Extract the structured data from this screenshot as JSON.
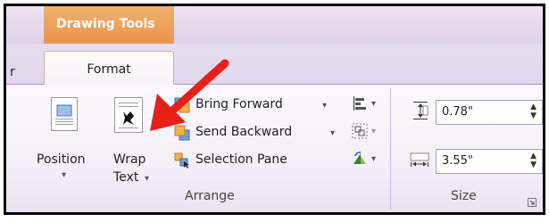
{
  "contextual_tab": {
    "title": "Drawing Tools"
  },
  "tabs": {
    "previous_partial": "r",
    "active": "Format"
  },
  "arrange": {
    "position_label": "Position",
    "wrap_text_label_1": "Wrap",
    "wrap_text_label_2": "Text",
    "bring_forward_label": "Bring Forward",
    "send_backward_label": "Send Backward",
    "selection_pane_label": "Selection Pane",
    "group_label": "Arrange",
    "dropdown_arrow": "▾"
  },
  "size": {
    "height_value": "0.78\"",
    "width_value": "3.55\"",
    "group_label": "Size"
  },
  "annotation": {
    "arrow_color": "#e8201a"
  },
  "icons": [
    "position-icon",
    "wrap-text-icon",
    "bring-forward-icon",
    "send-backward-icon",
    "selection-pane-icon",
    "align-icon",
    "group-icon",
    "rotate-icon",
    "shape-height-icon",
    "shape-width-icon",
    "dialog-launcher-icon"
  ]
}
